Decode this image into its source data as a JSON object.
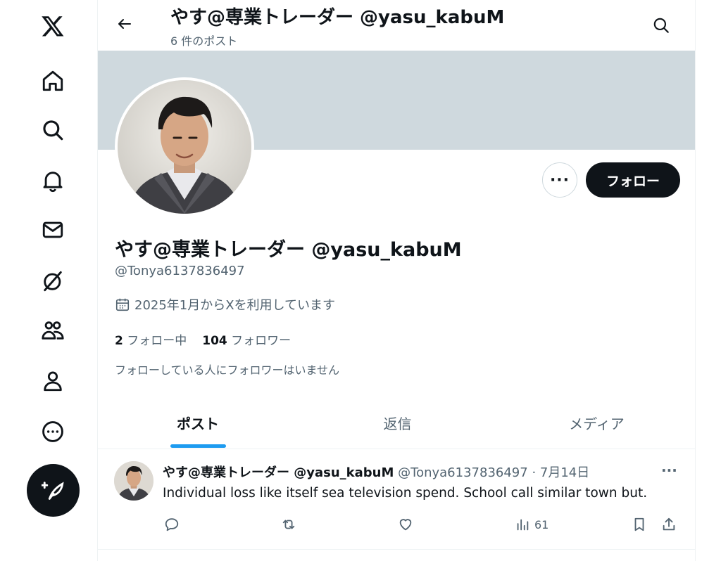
{
  "sidebar": {
    "icons": [
      "x-logo-icon",
      "home-icon",
      "explore-icon",
      "notifications-icon",
      "messages-icon",
      "grok-icon",
      "communities-icon",
      "profile-icon",
      "more-icon"
    ],
    "compose_icon": "compose-post-icon"
  },
  "header": {
    "display_name": "やす@専業トレーダー @yasu_kabuM",
    "post_count": "6 件のポスト"
  },
  "profile": {
    "display_name": "やす@専業トレーダー @yasu_kabuM",
    "handle": "@Tonya6137836497",
    "joined": "2025年1月からXを利用しています",
    "following_count": "2",
    "following_label": "フォロー中",
    "followers_count": "104",
    "followers_label": "フォロワー",
    "followers_note": "フォローしている人にフォロワーはいません",
    "more_label": "···",
    "follow_label": "フォロー"
  },
  "tabs": [
    {
      "label": "ポスト",
      "active": true
    },
    {
      "label": "返信",
      "active": false
    },
    {
      "label": "メディア",
      "active": false
    }
  ],
  "tweet": {
    "author_name": "やす@専業トレーダー @yasu_kabuM",
    "author_handle": "@Tonya6137836497",
    "date": "· 7月14日",
    "more": "···",
    "text": "Individual loss like itself sea television spend. School call similar town but.",
    "views": "61"
  },
  "colors": {
    "accent": "#1d9bf0",
    "banner": "#cfd9de",
    "text_primary": "#0f1419",
    "text_secondary": "#536471"
  }
}
